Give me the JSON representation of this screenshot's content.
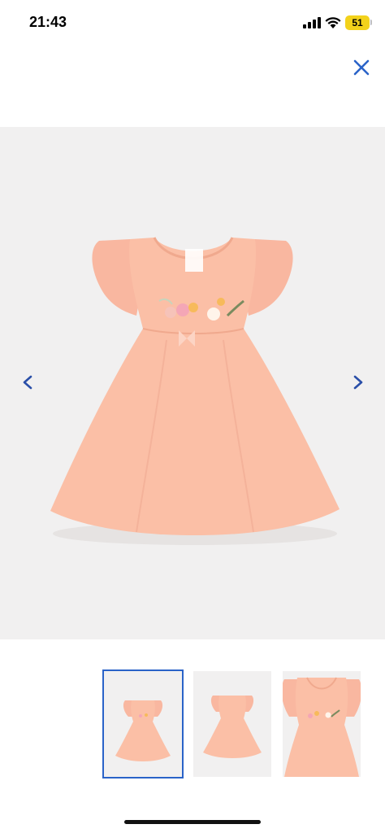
{
  "status_bar": {
    "time": "21:43",
    "battery": "51"
  },
  "gallery": {
    "total_images": 3,
    "selected_index": 0,
    "thumbnails": [
      {
        "name": "front-view"
      },
      {
        "name": "plain-front-view"
      },
      {
        "name": "detail-view"
      }
    ]
  },
  "colors": {
    "accent": "#2a63c8",
    "dress": "#fbbfa6",
    "background": "#f1f0f0"
  }
}
